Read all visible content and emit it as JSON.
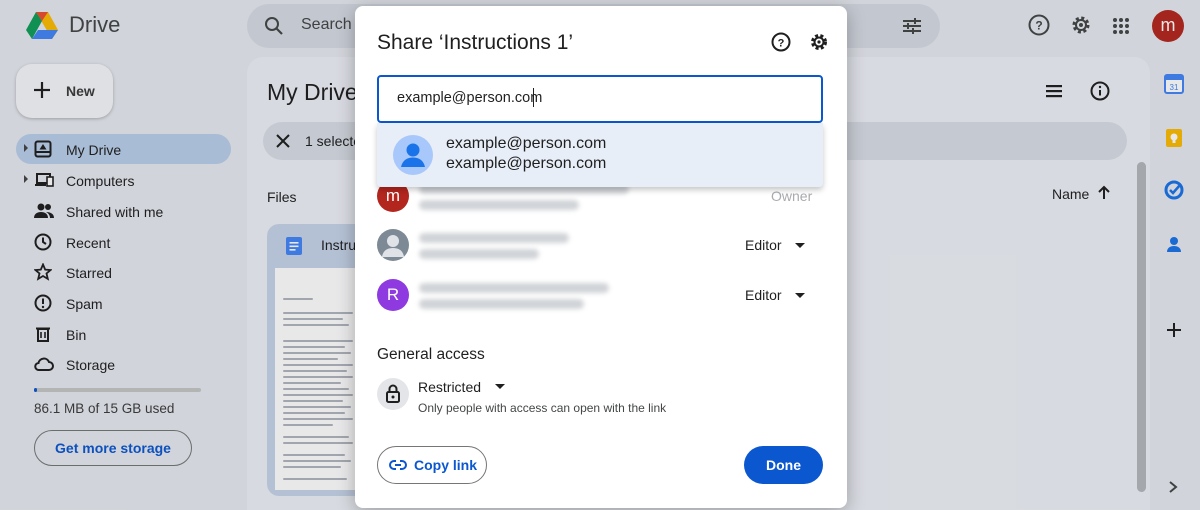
{
  "app": {
    "name": "Drive"
  },
  "search": {
    "placeholder": "Search"
  },
  "user": {
    "initial": "m"
  },
  "sidebar": {
    "new_label": "New",
    "items": [
      {
        "label": "My Drive",
        "icon": "my-drive-icon"
      },
      {
        "label": "Computers",
        "icon": "computers-icon"
      },
      {
        "label": "Shared with me",
        "icon": "shared-icon"
      },
      {
        "label": "Recent",
        "icon": "recent-icon"
      },
      {
        "label": "Starred",
        "icon": "star-icon"
      },
      {
        "label": "Spam",
        "icon": "spam-icon"
      },
      {
        "label": "Bin",
        "icon": "bin-icon"
      },
      {
        "label": "Storage",
        "icon": "cloud-icon"
      }
    ],
    "storage_used": "86.1 MB of 15 GB used",
    "storage_fraction": 0.0057,
    "get_storage": "Get more storage"
  },
  "main": {
    "title": "My Drive",
    "selection": "1 selecte",
    "files_label": "Files",
    "sort_label": "Name",
    "file_name": "Instru"
  },
  "dialog": {
    "title": "Share ‘Instructions 1’",
    "input_value": "example@person.com",
    "suggestion": {
      "name": "example@person.com",
      "email": "example@person.com"
    },
    "people": [
      {
        "initial": "m",
        "role": "Owner",
        "color": "#b3261e"
      },
      {
        "initial": "",
        "role": "Editor",
        "color": "#7d8a96"
      },
      {
        "initial": "R",
        "role": "Editor",
        "color": "#8e3ae0"
      }
    ],
    "general_access_title": "General access",
    "access_level": "Restricted",
    "access_description": "Only people with access can open with the link",
    "copy_link": "Copy link",
    "done": "Done"
  },
  "colors": {
    "accent": "#0b57d0",
    "active_nav": "#b9cfe9",
    "avatar": "#b3261e"
  }
}
